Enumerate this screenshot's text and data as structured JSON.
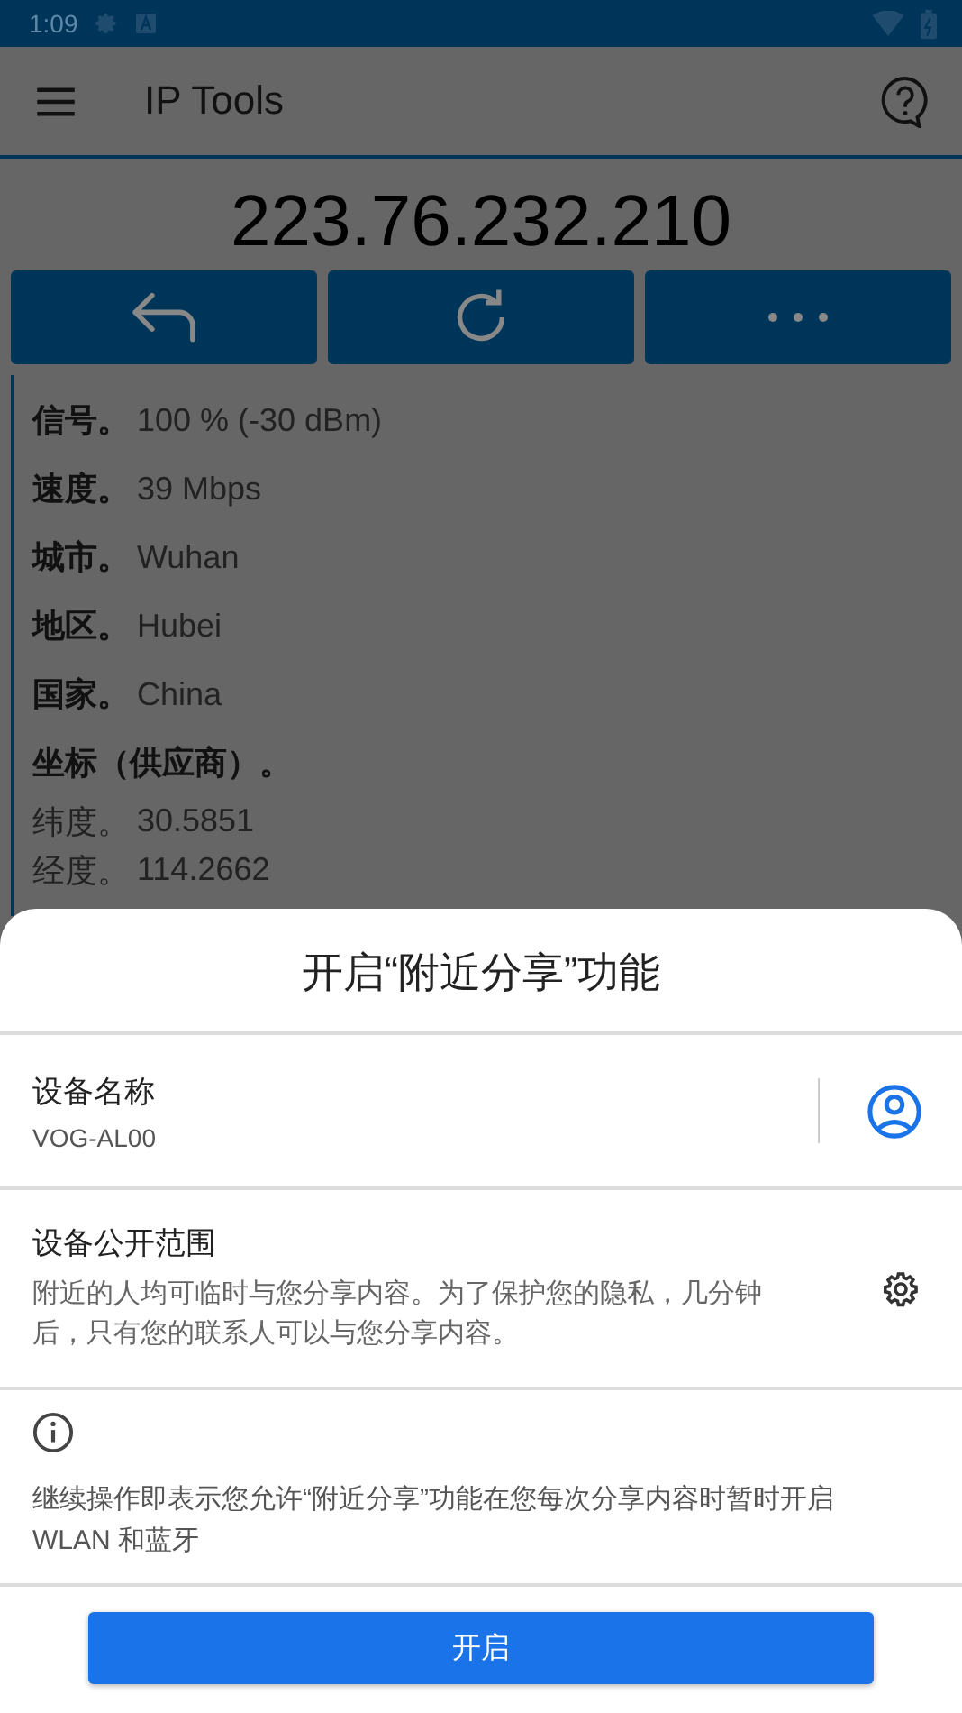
{
  "status_bar": {
    "time": "1:09"
  },
  "app_bar": {
    "title": "IP Tools"
  },
  "ip_address": "223.76.232.210",
  "info": [
    {
      "kind": "field",
      "label": "信号。",
      "value": "100 % (-30 dBm)"
    },
    {
      "kind": "field",
      "label": "速度。",
      "value": "39 Mbps"
    },
    {
      "kind": "field",
      "label": "城市。",
      "value": "Wuhan"
    },
    {
      "kind": "field",
      "label": "地区。",
      "value": "Hubei"
    },
    {
      "kind": "field",
      "label": "国家。",
      "value": "China"
    },
    {
      "kind": "heading",
      "label": "坐标（供应商）。"
    },
    {
      "kind": "sub",
      "label": "纬度。",
      "value": "30.5851"
    },
    {
      "kind": "sub",
      "label": "经度。",
      "value": "114.2662"
    }
  ],
  "sheet": {
    "title": "开启“附近分享”功能",
    "device_name": {
      "label": "设备名称",
      "value": "VOG-AL00"
    },
    "visibility": {
      "label": "设备公开范围",
      "description": "附近的人均可临时与您分享内容。为了保护您的隐私，几分钟后，只有您的联系人可以与您分享内容。"
    },
    "notice": "继续操作即表示您允许“附近分享”功能在您每次分享内容时暂时开启 WLAN 和蓝牙",
    "confirm_button": "开启"
  }
}
